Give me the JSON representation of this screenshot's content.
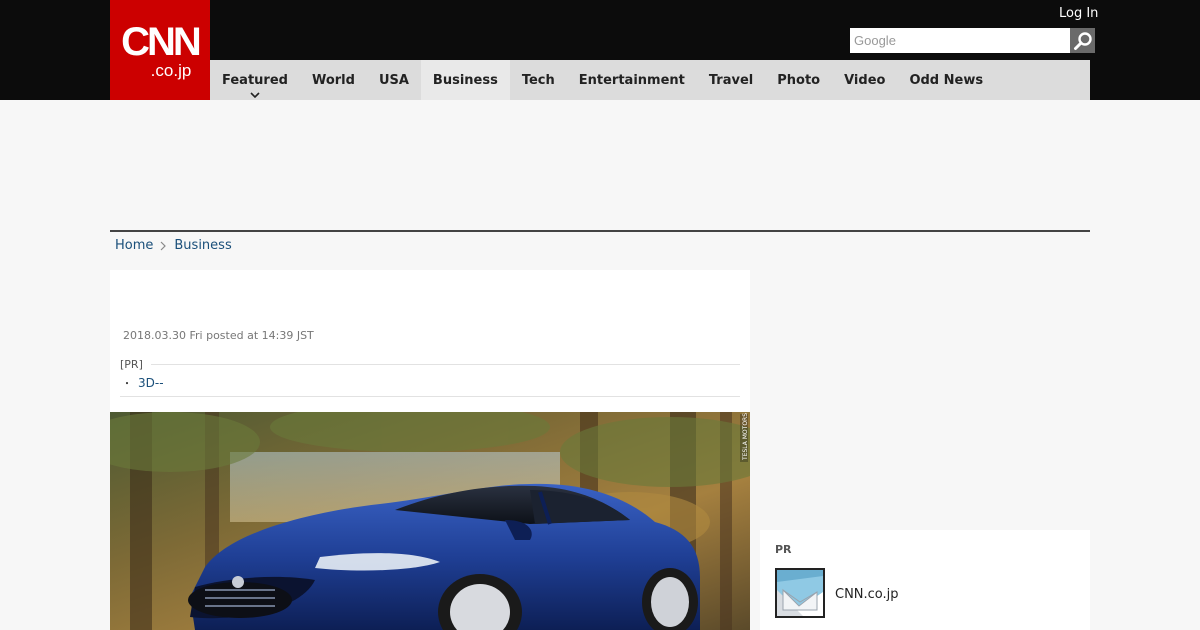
{
  "header": {
    "logo_main": "CNN",
    "logo_tld": ".co.jp",
    "login_label": "Log In",
    "search_placeholder": "Google",
    "search_icon": "magnifier-icon"
  },
  "nav": {
    "items": [
      {
        "label": "Featured"
      },
      {
        "label": "World"
      },
      {
        "label": "USA"
      },
      {
        "label": "Business"
      },
      {
        "label": "Tech"
      },
      {
        "label": "Entertainment"
      },
      {
        "label": "Travel"
      },
      {
        "label": "Photo"
      },
      {
        "label": "Video"
      },
      {
        "label": "Odd News"
      }
    ],
    "active": "Business",
    "featured_icon": "chevron-down-icon"
  },
  "breadcrumb": {
    "home": "Home",
    "section": "Business",
    "separator_icon": "chevron-right-icon"
  },
  "article": {
    "timestamp": "2018.03.30 Fri posted at 14:39 JST",
    "pr_label": "[PR]",
    "pr_bullet": "・",
    "pr_link": "3D--",
    "photo_credit": "TESLA MOTORS"
  },
  "sidebar": {
    "pr_label": "PR",
    "item_title": "CNN.co.jp"
  },
  "colors": {
    "brand_red": "#cc0000",
    "topbar": "#0c0c0c",
    "nav_bg": "#dcdcdc",
    "link": "#1a4f7a"
  }
}
